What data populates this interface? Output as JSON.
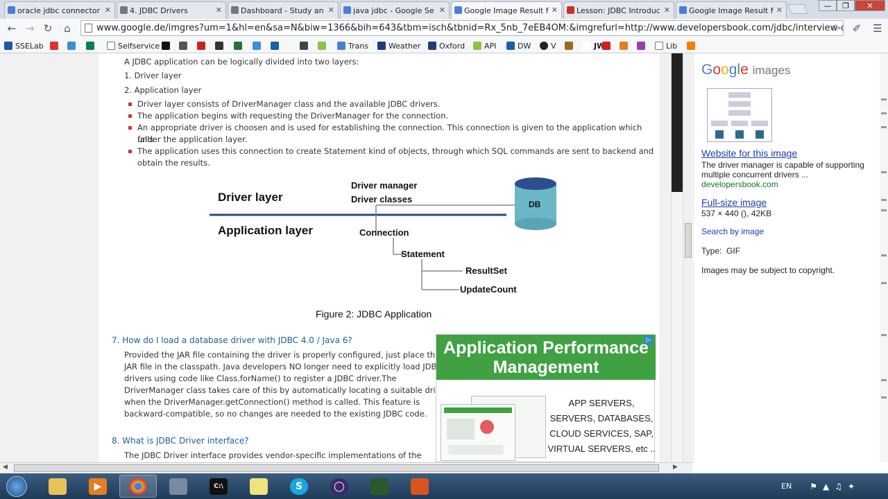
{
  "browser": {
    "tabs": [
      {
        "label": "oracle jdbc connector",
        "color": "#4a7fd4"
      },
      {
        "label": "4. JDBC Drivers",
        "color": "#666666"
      },
      {
        "label": "Dashboard - Study an",
        "color": "#666666"
      },
      {
        "label": "java jdbc - Google Se",
        "color": "#4a7fd4"
      },
      {
        "label": "Google Image Result f",
        "color": "#4a7fd4"
      },
      {
        "label": "Lesson: JDBC Introduc",
        "color": "#c8312a"
      },
      {
        "label": "Google Image Result f",
        "color": "#4a7fd4"
      }
    ],
    "url": "www.google.de/imgres?um=1&hl=en&sa=N&biw=1366&bih=643&tbm=isch&tbnid=Rx_5nb_7eEB4OM:&imgrefurl=http://www.developersbook.com/jdbc/interview-que",
    "bookmarks": [
      "SSELab",
      "Selfservice",
      "Trans",
      "Weather",
      "Oxford",
      "API",
      "DW",
      "V",
      "JW",
      "Lib"
    ]
  },
  "article": {
    "intro": "A JDBC application can be logically divided into two layers:",
    "layers": [
      "Driver layer",
      "Application layer"
    ],
    "bullets": [
      "Driver layer consists of DriverManager class and the available JDBC drivers.",
      "The application begins with requesting the DriverManager for the connection.",
      "An appropriate driver is choosen and is used for establishing the connection. This connection is given to the application which falls",
      "under the application layer.",
      "The application uses this connection to create Statement kind of objects, through which SQL commands are sent to backend and",
      "obtain the results."
    ],
    "diagram": {
      "driver_layer": "Driver layer",
      "application_layer": "Application layer",
      "driver_manager": "Driver manager",
      "driver_classes": "Driver classes",
      "db": "DB",
      "connection": "Connection",
      "statement": "Statement",
      "resultset": "ResultSet",
      "updatecount": "UpdateCount",
      "caption": "Figure 2: JDBC Application"
    },
    "q7": {
      "title": "7. How do I load a database driver with JDBC 4.0 / Java 6?",
      "lines": [
        "Provided the JAR file containing the driver is properly configured, just place the",
        "JAR file in the classpath. Java developers NO longer need to explicitly load JDBC",
        "drivers using code like Class.forName() to register a JDBC driver.The",
        "DriverManager class takes care of this by automatically locating a suitable driver",
        "when the DriverManager.getConnection() method is called. This feature is",
        "backward-compatible, so no changes are needed to the existing JDBC code."
      ]
    },
    "q8": {
      "title": "8. What is JDBC Driver interface?",
      "line": "The JDBC Driver interface provides vendor-specific implementations of the"
    }
  },
  "ad": {
    "headline": "Application Performance Management",
    "items": [
      "APP SERVERS,",
      "SERVERS, DATABASES,",
      "CLOUD SERVICES, SAP,",
      "VIRTUAL SERVERS, etc .."
    ]
  },
  "google_panel": {
    "logo": "Google images",
    "website_link": "Website for this image",
    "desc": "The driver manager is capable of supporting multiple concurrent drivers ...",
    "domain": "developersbook.com",
    "fullsize_link": "Full-size image",
    "size": "537 × 440 (), 42KB",
    "search_by_image": "Search by image",
    "type_label": "Type:",
    "type_value": "GIF",
    "copyright": "Images may be subject to copyright."
  },
  "taskbar": {
    "lang": "EN"
  }
}
